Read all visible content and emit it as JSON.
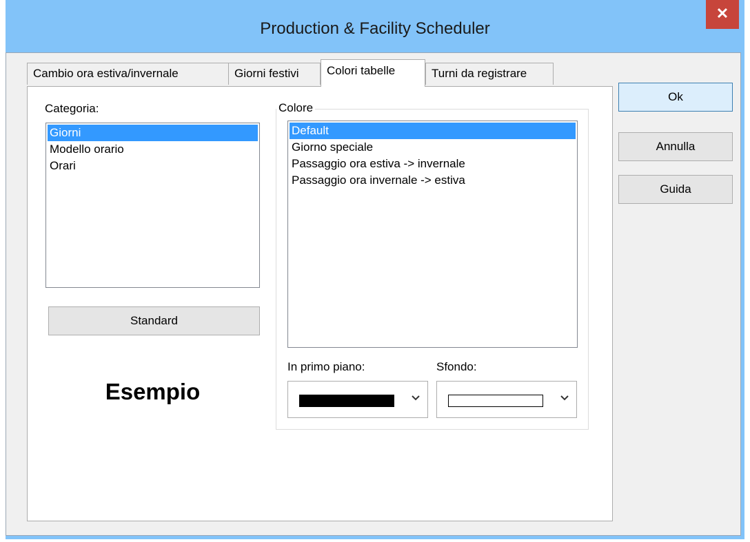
{
  "window": {
    "title": "Production & Facility Scheduler",
    "close_symbol": "✕"
  },
  "tabs": [
    {
      "label": "Cambio ora estiva/invernale"
    },
    {
      "label": "Giorni festivi"
    },
    {
      "label": "Colori tabelle"
    },
    {
      "label": "Turni da registrare"
    }
  ],
  "category": {
    "label": "Categoria:",
    "items": [
      "Giorni",
      "Modello orario",
      "Orari"
    ],
    "selected": "Giorni"
  },
  "standard_button": "Standard",
  "sample_text": "Esempio",
  "color_group": {
    "legend": "Colore",
    "items": [
      "Default",
      "Giorno speciale",
      "Passaggio ora estiva -> invernale",
      "Passaggio ora invernale -> estiva"
    ],
    "selected": "Default"
  },
  "foreground": {
    "label": "In primo piano:",
    "color": "#000000",
    "chevron": "chevron-down-icon"
  },
  "background": {
    "label": "Sfondo:",
    "color": "#ffffff",
    "chevron": "chevron-down-icon"
  },
  "buttons": {
    "ok": "Ok",
    "cancel": "Annulla",
    "help": "Guida"
  },
  "colors": {
    "title_bar": "#82c3f9",
    "close_button": "#c7453b",
    "selection": "#3399ff",
    "dialog_bg": "#f0f0f0"
  }
}
